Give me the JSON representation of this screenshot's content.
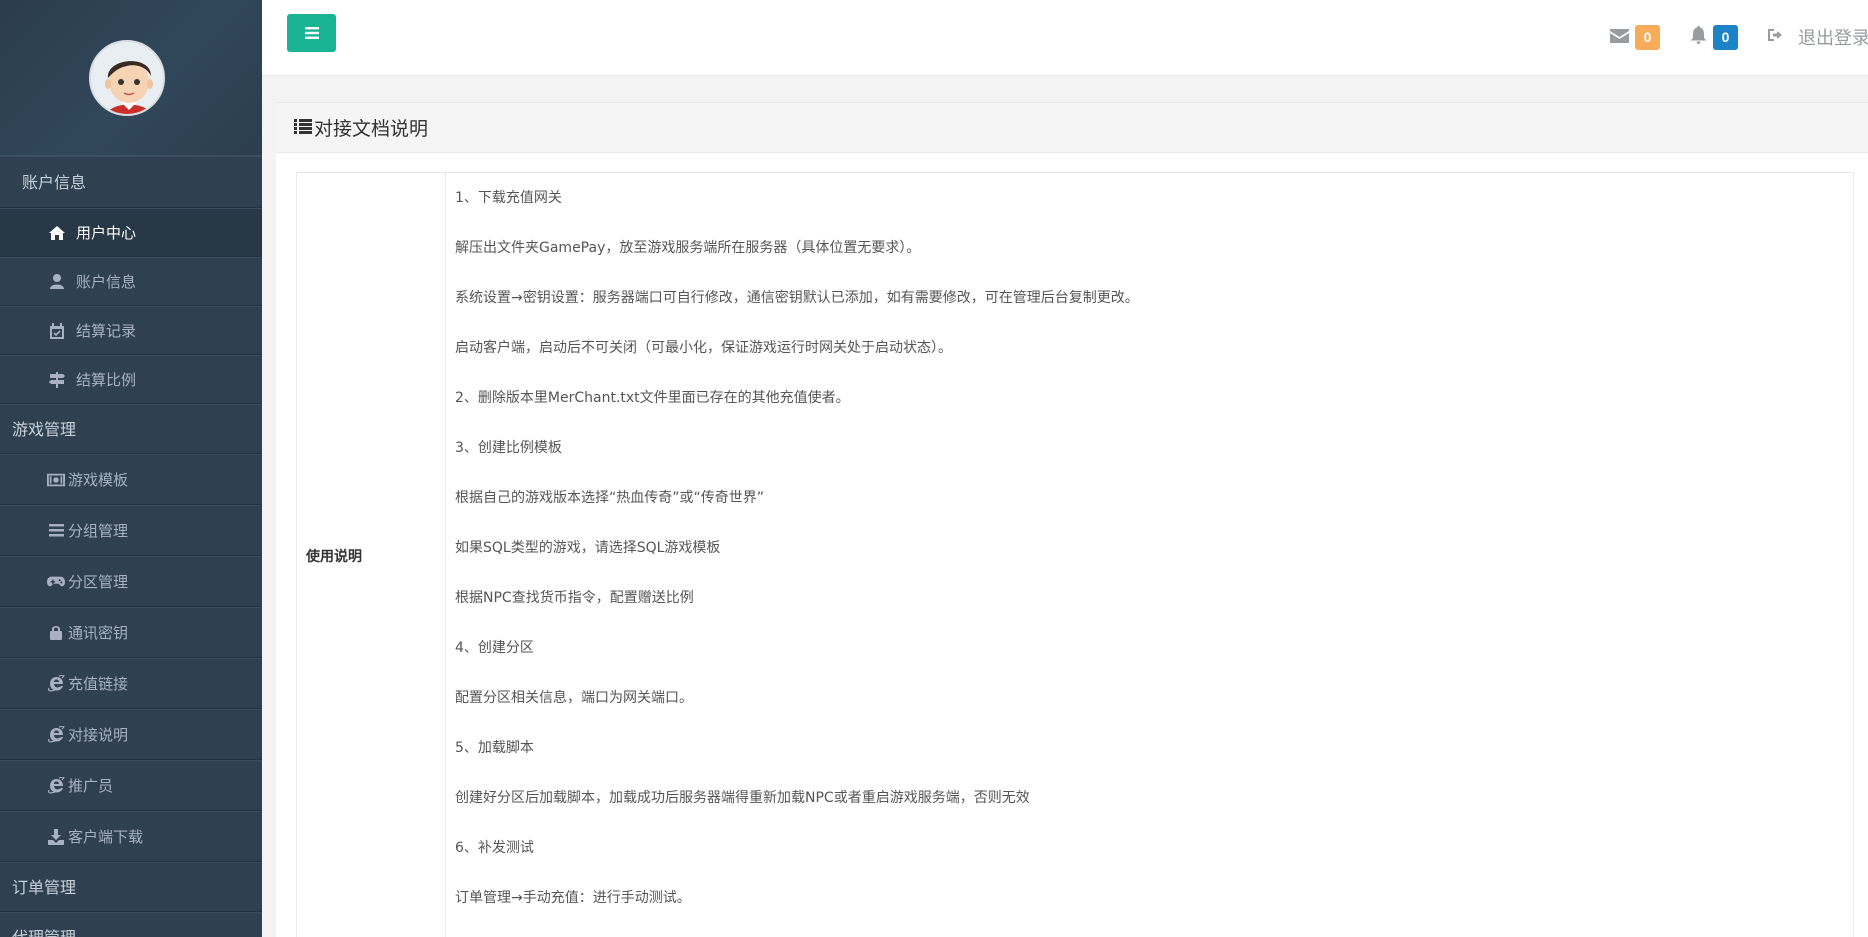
{
  "sidebar": {
    "sections": {
      "account": "账户信息",
      "game": "游戏管理",
      "orders": "订单管理",
      "agent": "代理管理"
    },
    "account_items": [
      {
        "label": "用户中心",
        "icon": "home-icon",
        "active": true
      },
      {
        "label": "账户信息",
        "icon": "user-icon"
      },
      {
        "label": "结算记录",
        "icon": "calendar-check-icon"
      },
      {
        "label": "结算比例",
        "icon": "signpost-icon"
      }
    ],
    "game_items": [
      {
        "label": "游戏模板",
        "icon": "money-icon"
      },
      {
        "label": "分组管理",
        "icon": "bars-icon"
      },
      {
        "label": "分区管理",
        "icon": "gamepad-icon"
      },
      {
        "label": "通讯密钥",
        "icon": "lock-icon"
      },
      {
        "label": "充值链接",
        "icon": "ie-icon"
      },
      {
        "label": "对接说明",
        "icon": "ie-icon"
      },
      {
        "label": "推广员",
        "icon": "ie-icon"
      },
      {
        "label": "客户端下载",
        "icon": "download-icon"
      }
    ]
  },
  "topbar": {
    "mail_count": "0",
    "notification_count": "0",
    "logout_label": "退出登录",
    "colors": {
      "menu_button": "#1ab394",
      "mail_badge": "#f8ac59",
      "notify_badge": "#1c84c6"
    }
  },
  "panel": {
    "title": "对接文档说明",
    "row_label": "使用说明",
    "lines": [
      "1、下载充值网关",
      "解压出文件夹GamePay，放至游戏服务端所在服务器（具体位置无要求）。",
      "系统设置→密钥设置：服务器端口可自行修改，通信密钥默认已添加，如有需要修改，可在管理后台复制更改。",
      "启动客户端，启动后不可关闭（可最小化，保证游戏运行时网关处于启动状态）。",
      "2、删除版本里MerChant.txt文件里面已存在的其他充值使者。",
      "3、创建比例模板",
      "根据自己的游戏版本选择“热血传奇”或“传奇世界”",
      "如果SQL类型的游戏，请选择SQL游戏模板",
      "根据NPC查找货币指令，配置赠送比例",
      "4、创建分区",
      "配置分区相关信息，端口为网关端口。",
      "5、加载脚本",
      "创建好分区后加载脚本，加载成功后服务器端得重新加载NPC或者重启游戏服务端，否则无效",
      "6、补发测试",
      "订单管理→手动充值：进行手动测试。"
    ]
  }
}
